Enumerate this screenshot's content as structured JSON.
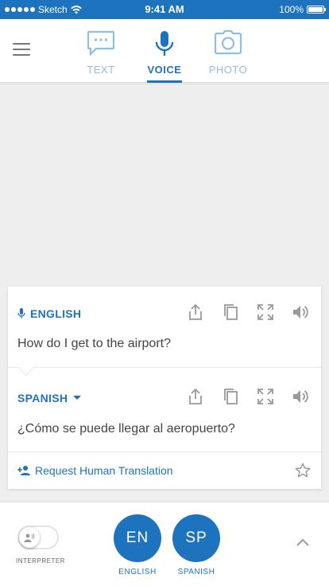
{
  "status_bar": {
    "carrier": "Sketch",
    "time": "9:41 AM",
    "battery": "100%",
    "battery_level": 1.0
  },
  "tabs": [
    {
      "label": "TEXT",
      "icon": "chat-bubble-icon",
      "active": false
    },
    {
      "label": "VOICE",
      "icon": "microphone-icon",
      "active": true
    },
    {
      "label": "PHOTO",
      "icon": "camera-icon",
      "active": false
    }
  ],
  "translation": {
    "source": {
      "language": "ENGLISH",
      "text": "How do I get to the airport?"
    },
    "target": {
      "language": "SPANISH",
      "text": "¿Cómo se puede llegar al aeropuerto?"
    },
    "actions": [
      "share-icon",
      "copy-icon",
      "fullscreen-icon",
      "speaker-icon"
    ],
    "request_label": "Request Human Translation"
  },
  "bottom_bar": {
    "interpreter_label": "INTERPRETER",
    "interpreter_on": false,
    "languages": [
      {
        "code": "EN",
        "name": "ENGLISH"
      },
      {
        "code": "SP",
        "name": "SPANISH"
      }
    ]
  },
  "colors": {
    "primary": "#1e73be",
    "inactive_tab": "#8ebfe2",
    "background": "#eeeeee"
  }
}
